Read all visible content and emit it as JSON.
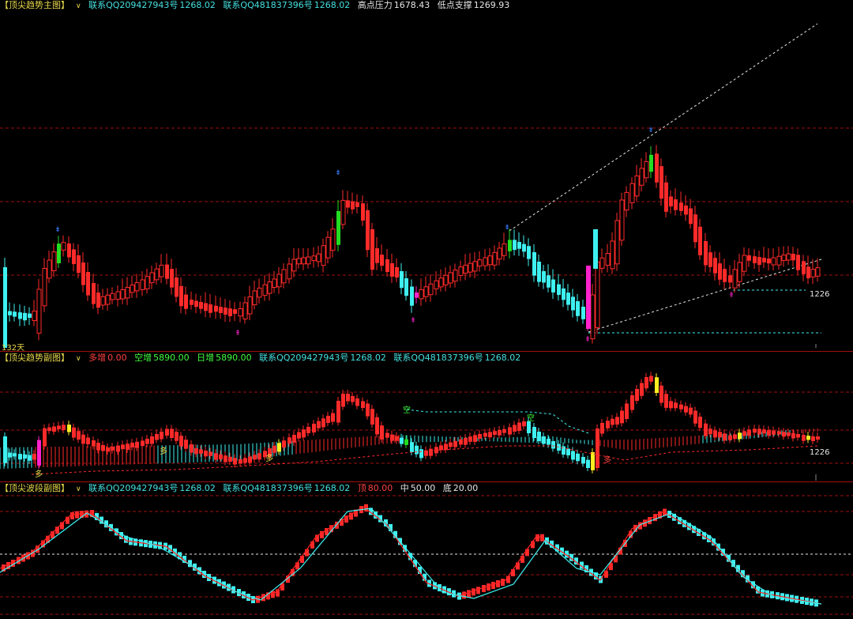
{
  "main_panel": {
    "title": "【顶尖趋势主图】",
    "contact1_label": "联系QQ209427943号",
    "contact1_value": "1268.02",
    "contact2_label": "联系QQ481837396号",
    "contact2_value": "1268.02",
    "high_label": "高点压力",
    "high_value": "1678.43",
    "low_label": "低点支撑",
    "low_value": "1269.93",
    "days_label": "132天",
    "price_marker": "1226"
  },
  "trend_panel": {
    "title": "【顶尖趋势副图】",
    "duo_label": "多增",
    "duo_value": "0.00",
    "kong_label": "空增",
    "kong_value": "5890.00",
    "ri_label": "日增",
    "ri_value": "5890.00",
    "contact1_label": "联系QQ209427943号",
    "contact1_value": "1268.02",
    "contact2_label": "联系QQ481837396号",
    "contact2_value": "1268.02",
    "price_marker": "1226",
    "tag_duo": "多",
    "tag_kong": "空"
  },
  "wave_panel": {
    "title": "【顶尖波段副图】",
    "contact1_label": "联系QQ209427943号",
    "contact1_value": "1268.02",
    "contact2_label": "联系QQ481837396号",
    "contact2_value": "1268.02",
    "top_label": "顶",
    "top_value": "80.00",
    "mid_label": "中",
    "mid_value": "50.00",
    "bottom_label": "底",
    "bottom_value": "20.00"
  },
  "colors": {
    "up": "#ff2a2a",
    "down": "#3ff0f0",
    "signal_green": "#22dd22",
    "signal_magenta": "#ff22cc",
    "signal_yellow": "#ffee22",
    "grid": "#a01010"
  }
}
